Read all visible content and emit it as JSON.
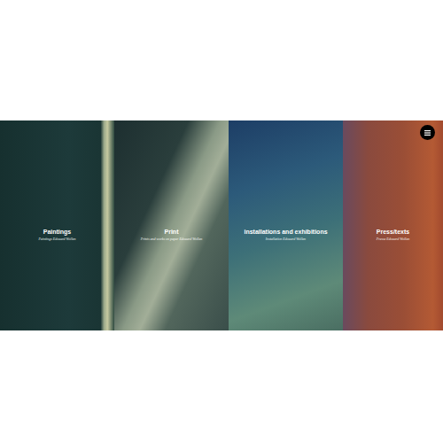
{
  "panels": [
    {
      "title": "Paintings",
      "subtitle": "Paintings Edouard Wollen"
    },
    {
      "title": "Print",
      "subtitle": "Prints and works on paper Edouard Wollen"
    },
    {
      "title": "installations and exhibitions",
      "subtitle": "Installation Edouard Wollen"
    },
    {
      "title": "Press/texts",
      "subtitle": "Presse Edouard Wollen"
    }
  ]
}
